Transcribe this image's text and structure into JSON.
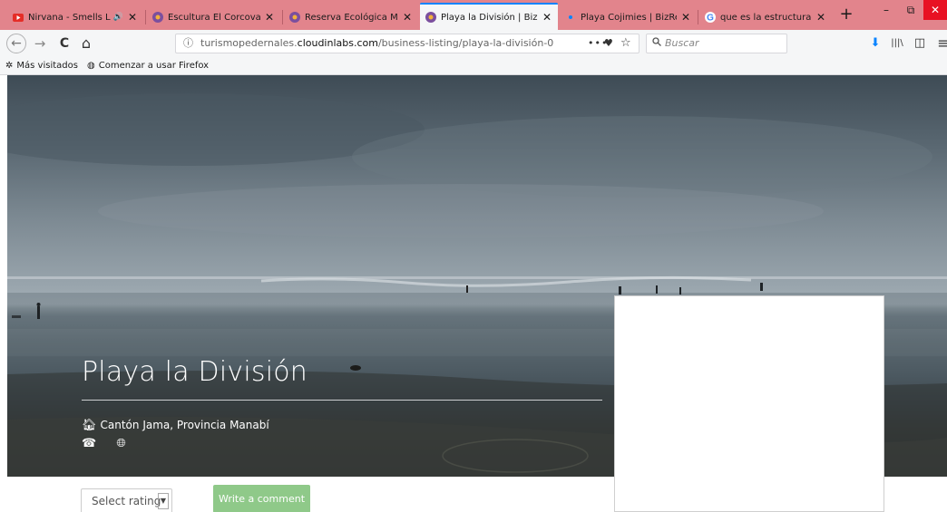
{
  "browser": {
    "tabs": [
      {
        "title": "Nirvana - Smells Like T",
        "favicon": "youtube-icon",
        "audio": "🔊",
        "close": "✕"
      },
      {
        "title": "Escultura El Corcovado de",
        "favicon": "bizreview-icon",
        "close": "✕"
      },
      {
        "title": "Reserva Ecológica Mache",
        "favicon": "bizreview-icon",
        "close": "✕"
      },
      {
        "title": "Playa la División | BizRevie",
        "favicon": "bizreview-icon",
        "close": "✕",
        "active": true
      },
      {
        "title": "Playa Cojimies | BizReview",
        "favicon": "loading-icon",
        "close": "✕"
      },
      {
        "title": "que es la estructuracion le",
        "favicon": "google-icon",
        "close": "✕"
      }
    ],
    "new_tab": "+",
    "window": {
      "minimize": "–",
      "restore": "⧉",
      "close": "✕"
    },
    "nav": {
      "back": "←",
      "forward": "→",
      "reload": "C",
      "home": "⌂"
    },
    "url": {
      "prefix": "turismopedernales.",
      "host": "cloudinlabs.com",
      "path": "/business-listing/playa-la-división-0",
      "info_icon": "ⓘ",
      "more": "•••",
      "pocket": "♥",
      "bookmark": "☆"
    },
    "search": {
      "placeholder": "Buscar",
      "icon": "🔍"
    },
    "toolbar": {
      "download": "⬇",
      "library": "|||\\",
      "sidebar": "◫",
      "menu": "≡"
    },
    "bookmarks": [
      {
        "label": "Más visitados",
        "icon": "gear-icon"
      },
      {
        "label": "Comenzar a usar Firefox",
        "icon": "firefox-icon"
      }
    ]
  },
  "listing": {
    "title": "Playa la División",
    "location": "Cantón Jama, Provincia Manabí",
    "rating_select": "Select rating",
    "comment_button": "Write a comment"
  },
  "colors": {
    "tab_strip": "#e2848c",
    "accent_blue": "#0a84ff",
    "comment_button": "#8fc989"
  }
}
